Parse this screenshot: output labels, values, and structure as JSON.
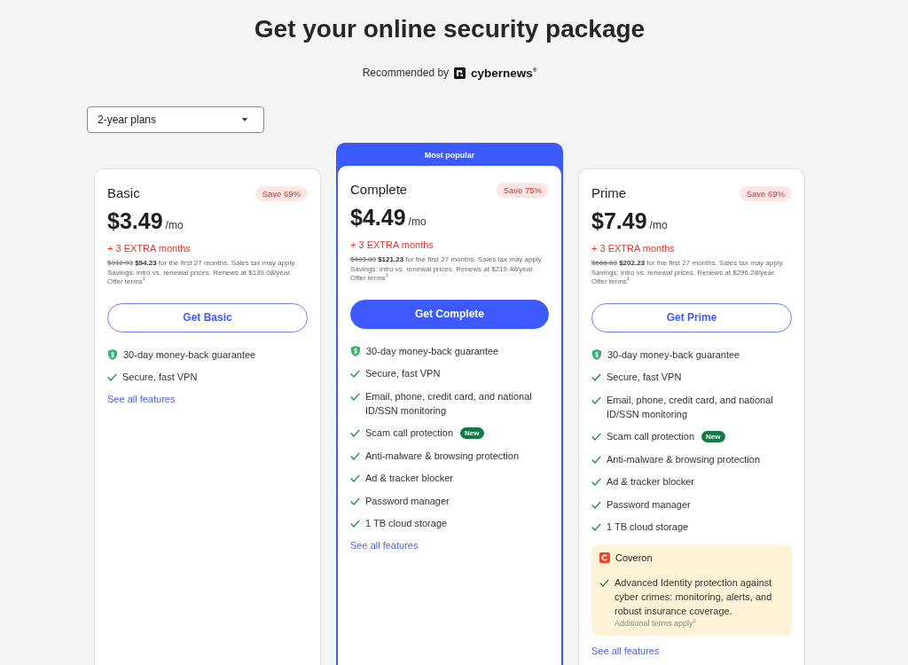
{
  "title": "Get your online security package",
  "recommendation": {
    "label": "Recommended by",
    "brand": "cybernews$^{®}$"
  },
  "plan_selector": {
    "value": "2-year plans"
  },
  "plans": [
    {
      "name": "Basic",
      "highlighted": false,
      "badge": "Save 69%",
      "price": "$3.49",
      "unit": "/mo",
      "bonus": "+ 3 EXTRA months",
      "old_price": "$312.93",
      "price_note": "**$94.23** for the first 27 months. Sales tax may apply. Savings: intro vs. renewal prices. Renews at $139.08/year. Offer terms$^{1}$",
      "cta": "Get Basic",
      "features": [
        {
          "kind": "guarantee",
          "text": "30-day money-back guarantee"
        },
        {
          "kind": "check",
          "text": "Secure, fast VPN"
        }
      ],
      "link": "See all features"
    },
    {
      "name": "Complete",
      "ribbon": "Most popular",
      "highlighted": true,
      "badge": "Save 75%",
      "price": "$4.49",
      "unit": "/mo",
      "bonus": "+ 3 EXTRA months",
      "old_price": "$493.83",
      "price_note": "**$121.23** for the first 27 months. Sales tax may apply. Savings: intro vs. renewal prices. Renews at $219.48/year. Offer terms$^{1}$",
      "cta": "Get Complete",
      "features": [
        {
          "kind": "guarantee",
          "text": "30-day money-back guarantee"
        },
        {
          "kind": "check",
          "text": "Secure, fast VPN"
        },
        {
          "kind": "check",
          "text": "Email, phone, credit card, and national ID/SSN monitoring"
        },
        {
          "kind": "check",
          "text": "Scam call protection",
          "badge": "New"
        },
        {
          "kind": "check",
          "text": "Anti-malware & browsing protection"
        },
        {
          "kind": "check",
          "text": "Ad & tracker blocker"
        },
        {
          "kind": "check",
          "text": "Password manager"
        },
        {
          "kind": "check",
          "text": "1 TB cloud storage"
        }
      ],
      "link": "See all features"
    },
    {
      "name": "Prime",
      "highlighted": false,
      "badge": "Save 69%",
      "price": "$7.49",
      "unit": "/mo",
      "bonus": "+ 3 EXTRA months",
      "old_price": "$666.63",
      "price_note": "**$202.23** for the first 27 months. Sales tax may apply. Savings: intro vs. renewal prices. Renews at $296.28/year. Offer terms$^{1}$",
      "cta": "Get Prime",
      "features": [
        {
          "kind": "guarantee",
          "text": "30-day money-back guarantee"
        },
        {
          "kind": "check",
          "text": "Secure, fast VPN"
        },
        {
          "kind": "check",
          "text": "Email, phone, credit card, and national ID/SSN monitoring"
        },
        {
          "kind": "check",
          "text": "Scam call protection",
          "badge": "New"
        },
        {
          "kind": "check",
          "text": "Anti-malware & browsing protection"
        },
        {
          "kind": "check",
          "text": "Ad & tracker blocker"
        },
        {
          "kind": "check",
          "text": "Password manager"
        },
        {
          "kind": "check",
          "text": "1 TB cloud storage"
        }
      ],
      "addon": {
        "name": "Coveron",
        "features": [
          {
            "kind": "check",
            "text": "Advanced Identity protection against cyber crimes: monitoring, alerts, and robust insurance coverage."
          }
        ],
        "note": "Additional terms apply$^{2}$"
      },
      "link": "See all features"
    }
  ]
}
